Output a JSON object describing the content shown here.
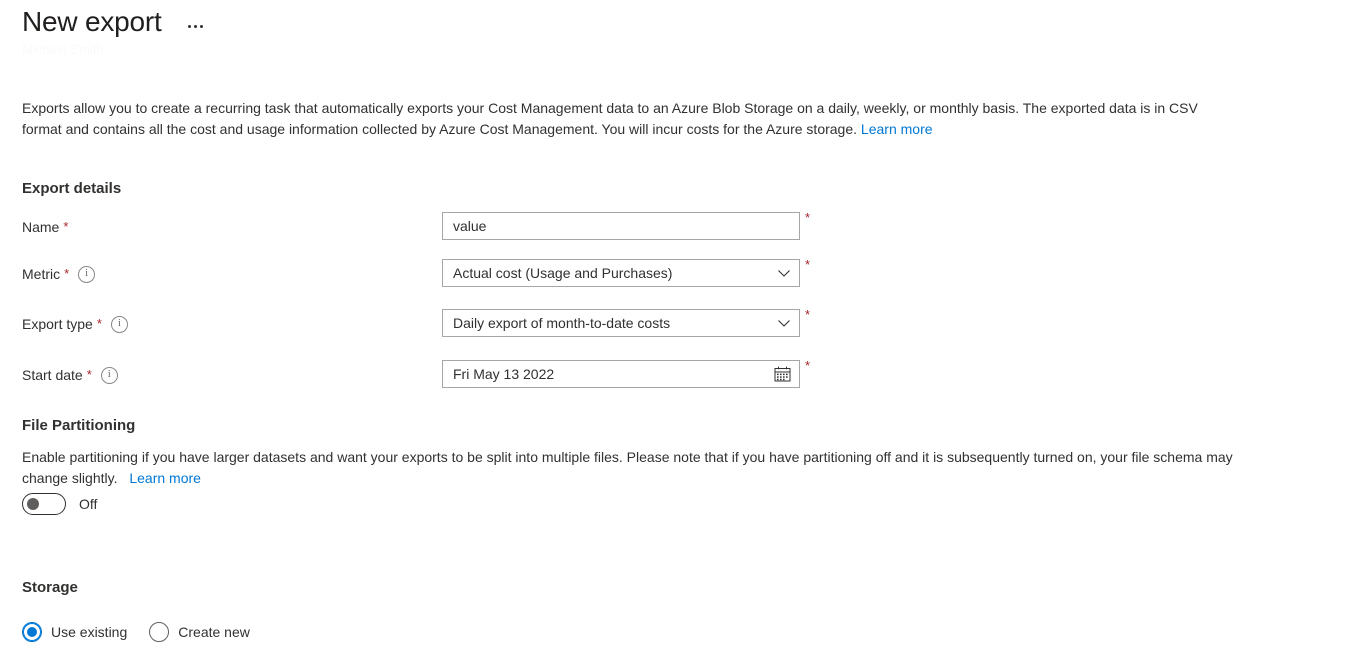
{
  "header": {
    "title": "New export",
    "subtitle": "Michael Smith",
    "more_menu_label": "..."
  },
  "intro": {
    "text": "Exports allow you to create a recurring task that automatically exports your Cost Management data to an Azure Blob Storage on a daily, weekly, or monthly basis. The exported data is in CSV format and contains all the cost and usage information collected by Azure Cost Management. You will incur costs for the Azure storage.",
    "link_label": "Learn more"
  },
  "export_details": {
    "heading": "Export details",
    "required_marker": "*",
    "fields": [
      {
        "label": "Name",
        "required_marker": "*",
        "has_info": false,
        "value": "value",
        "placeholder": "",
        "control": "textbox"
      },
      {
        "label": "Metric",
        "required_marker": "*",
        "has_info": true,
        "info_icon": "info-icon",
        "value": "Actual cost (Usage and Purchases)",
        "placeholder": "",
        "control": "dropdown",
        "dropdown_icon": "chevron-down-icon"
      },
      {
        "label": "Export type",
        "required_marker": "*",
        "has_info": true,
        "info_icon": "info-icon",
        "value": "Daily export of month-to-date costs",
        "placeholder": "",
        "control": "dropdown",
        "dropdown_icon": "chevron-down-icon"
      },
      {
        "label": "Start date",
        "required_marker": "*",
        "has_info": true,
        "info_icon": "info-icon",
        "value": "Fri May 13 2022",
        "placeholder": "",
        "control": "datepicker",
        "date_icon": "calendar-icon"
      }
    ]
  },
  "file_partitioning": {
    "heading": "File Partitioning",
    "description": "Enable partitioning if you have larger datasets and want your exports to be split into multiple files. Please note that if you have partitioning off and it is subsequently turned on, your file schema may change slightly.",
    "link_label": "Learn more",
    "toggle_state": "Off",
    "toggle_on": false
  },
  "storage": {
    "heading": "Storage",
    "selected": "Use existing",
    "options": [
      {
        "label": "Use existing",
        "selected": true
      },
      {
        "label": "Create new",
        "selected": false
      }
    ]
  },
  "colors": {
    "accent": "#0078d4",
    "required_red": "#a4262c",
    "text": "#323130",
    "border": "#a6a6a6",
    "background": "#ffffff"
  }
}
